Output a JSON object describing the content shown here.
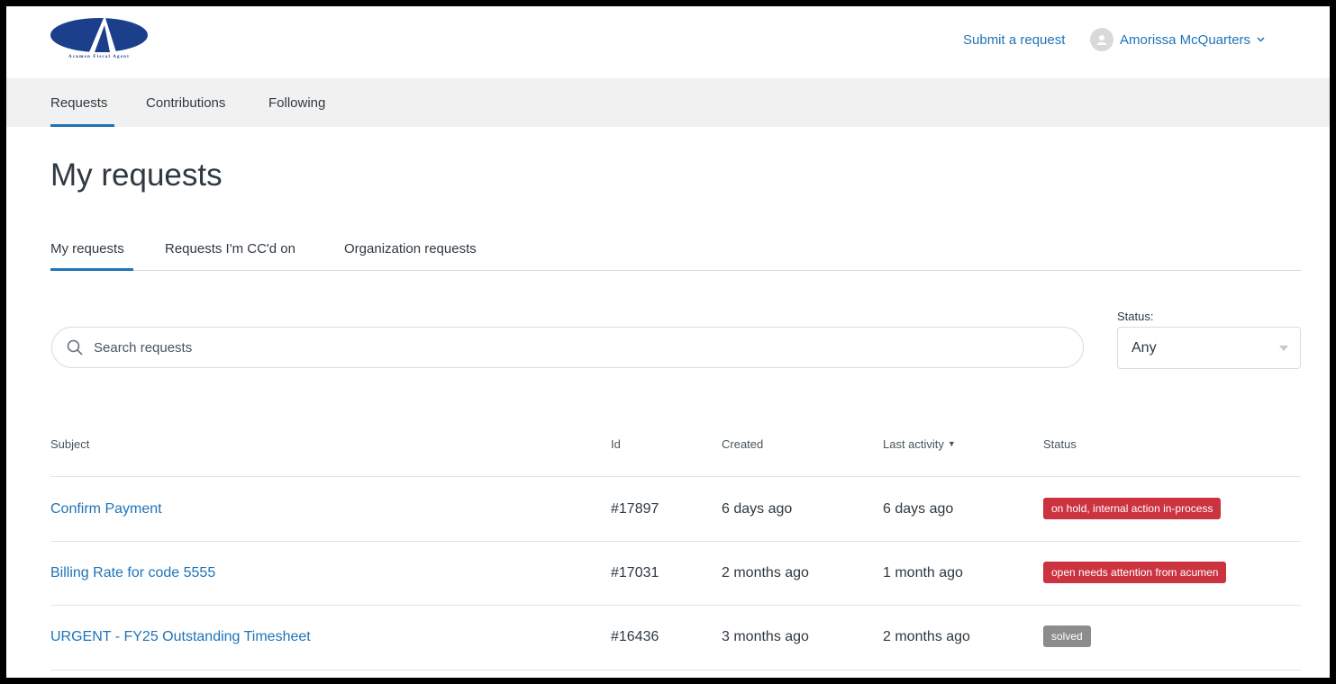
{
  "header": {
    "logo_text": "Acumen Fiscal Agent",
    "submit_link": "Submit a request",
    "user_name": "Amorissa McQuarters"
  },
  "nav": {
    "items": [
      {
        "label": "Requests",
        "active": true
      },
      {
        "label": "Contributions"
      },
      {
        "label": "Following"
      }
    ]
  },
  "page": {
    "title": "My requests"
  },
  "subtabs": {
    "items": [
      {
        "label": "My requests",
        "active": true
      },
      {
        "label": "Requests I'm CC'd on"
      },
      {
        "label": "Organization requests"
      }
    ]
  },
  "search": {
    "placeholder": "Search requests"
  },
  "status_filter": {
    "label": "Status:",
    "value": "Any"
  },
  "table": {
    "headers": {
      "subject": "Subject",
      "id": "Id",
      "created": "Created",
      "last_activity": "Last activity",
      "status": "Status"
    },
    "sort_indicator": "▼",
    "rows": [
      {
        "subject": "Confirm Payment",
        "id": "#17897",
        "created": "6 days ago",
        "last_activity": "6 days ago",
        "status": "on hold, internal action in-process",
        "status_color": "#cc3340"
      },
      {
        "subject": "Billing Rate for code 5555",
        "id": "#17031",
        "created": "2 months ago",
        "last_activity": "1 month ago",
        "status": "open needs attention from acumen",
        "status_color": "#cc3340"
      },
      {
        "subject": "URGENT - FY25 Outstanding Timesheet",
        "id": "#16436",
        "created": "3 months ago",
        "last_activity": "2 months ago",
        "status": "solved",
        "status_color": "#8c8c8c"
      }
    ]
  },
  "colors": {
    "link": "#1f73b7",
    "accent": "#1f73b7",
    "logo_blue": "#1b3f8a",
    "nav_bg": "#f1f1f1"
  }
}
